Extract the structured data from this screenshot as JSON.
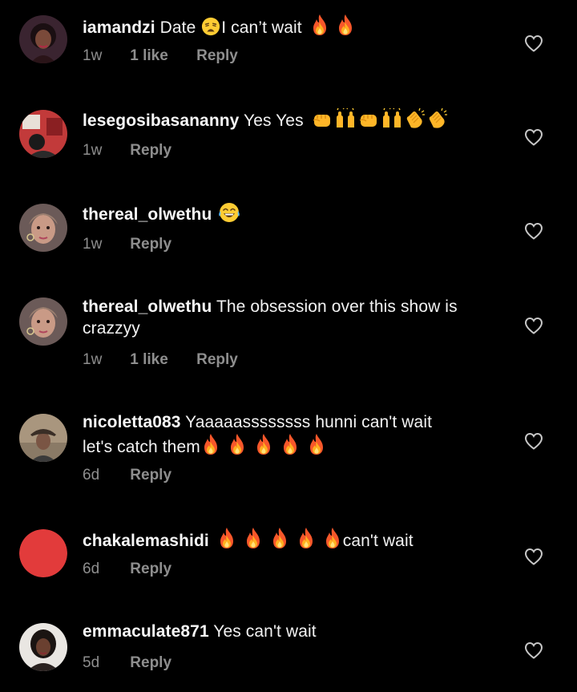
{
  "colors": {
    "background": "#000000",
    "text": "#f2f2f2",
    "meta": "#8e8e8e",
    "heart": "#c7c7c7"
  },
  "comments": [
    {
      "avatar_icon": "profile-photo",
      "username": "iamandzi",
      "text_before": "Date",
      "text_after": "I can’t wait",
      "time": "1w",
      "likes": "1 like",
      "reply": "Reply"
    },
    {
      "avatar_icon": "profile-photo",
      "username": "lesegosibasananny",
      "text": "Yes Yes",
      "time": "1w",
      "reply": "Reply"
    },
    {
      "avatar_icon": "profile-photo",
      "username": "thereal_olwethu",
      "time": "1w",
      "reply": "Reply"
    },
    {
      "avatar_icon": "profile-photo",
      "username": "thereal_olwethu",
      "text": "The obsession over this show is crazzyy",
      "time": "1w",
      "likes": "1 like",
      "reply": "Reply"
    },
    {
      "avatar_icon": "profile-photo",
      "username": "nicoletta083",
      "text_line1": "Yaaaaassssssss hunni can't wait",
      "text_line2": "let's catch them",
      "time": "6d",
      "reply": "Reply"
    },
    {
      "avatar_icon": "red-circle-avatar",
      "username": "chakalemashidi",
      "text_after": "can't wait",
      "time": "6d",
      "reply": "Reply"
    },
    {
      "avatar_icon": "profile-photo",
      "username": "emmaculate871",
      "text": "Yes can't wait",
      "time": "5d",
      "reply": "Reply"
    }
  ]
}
